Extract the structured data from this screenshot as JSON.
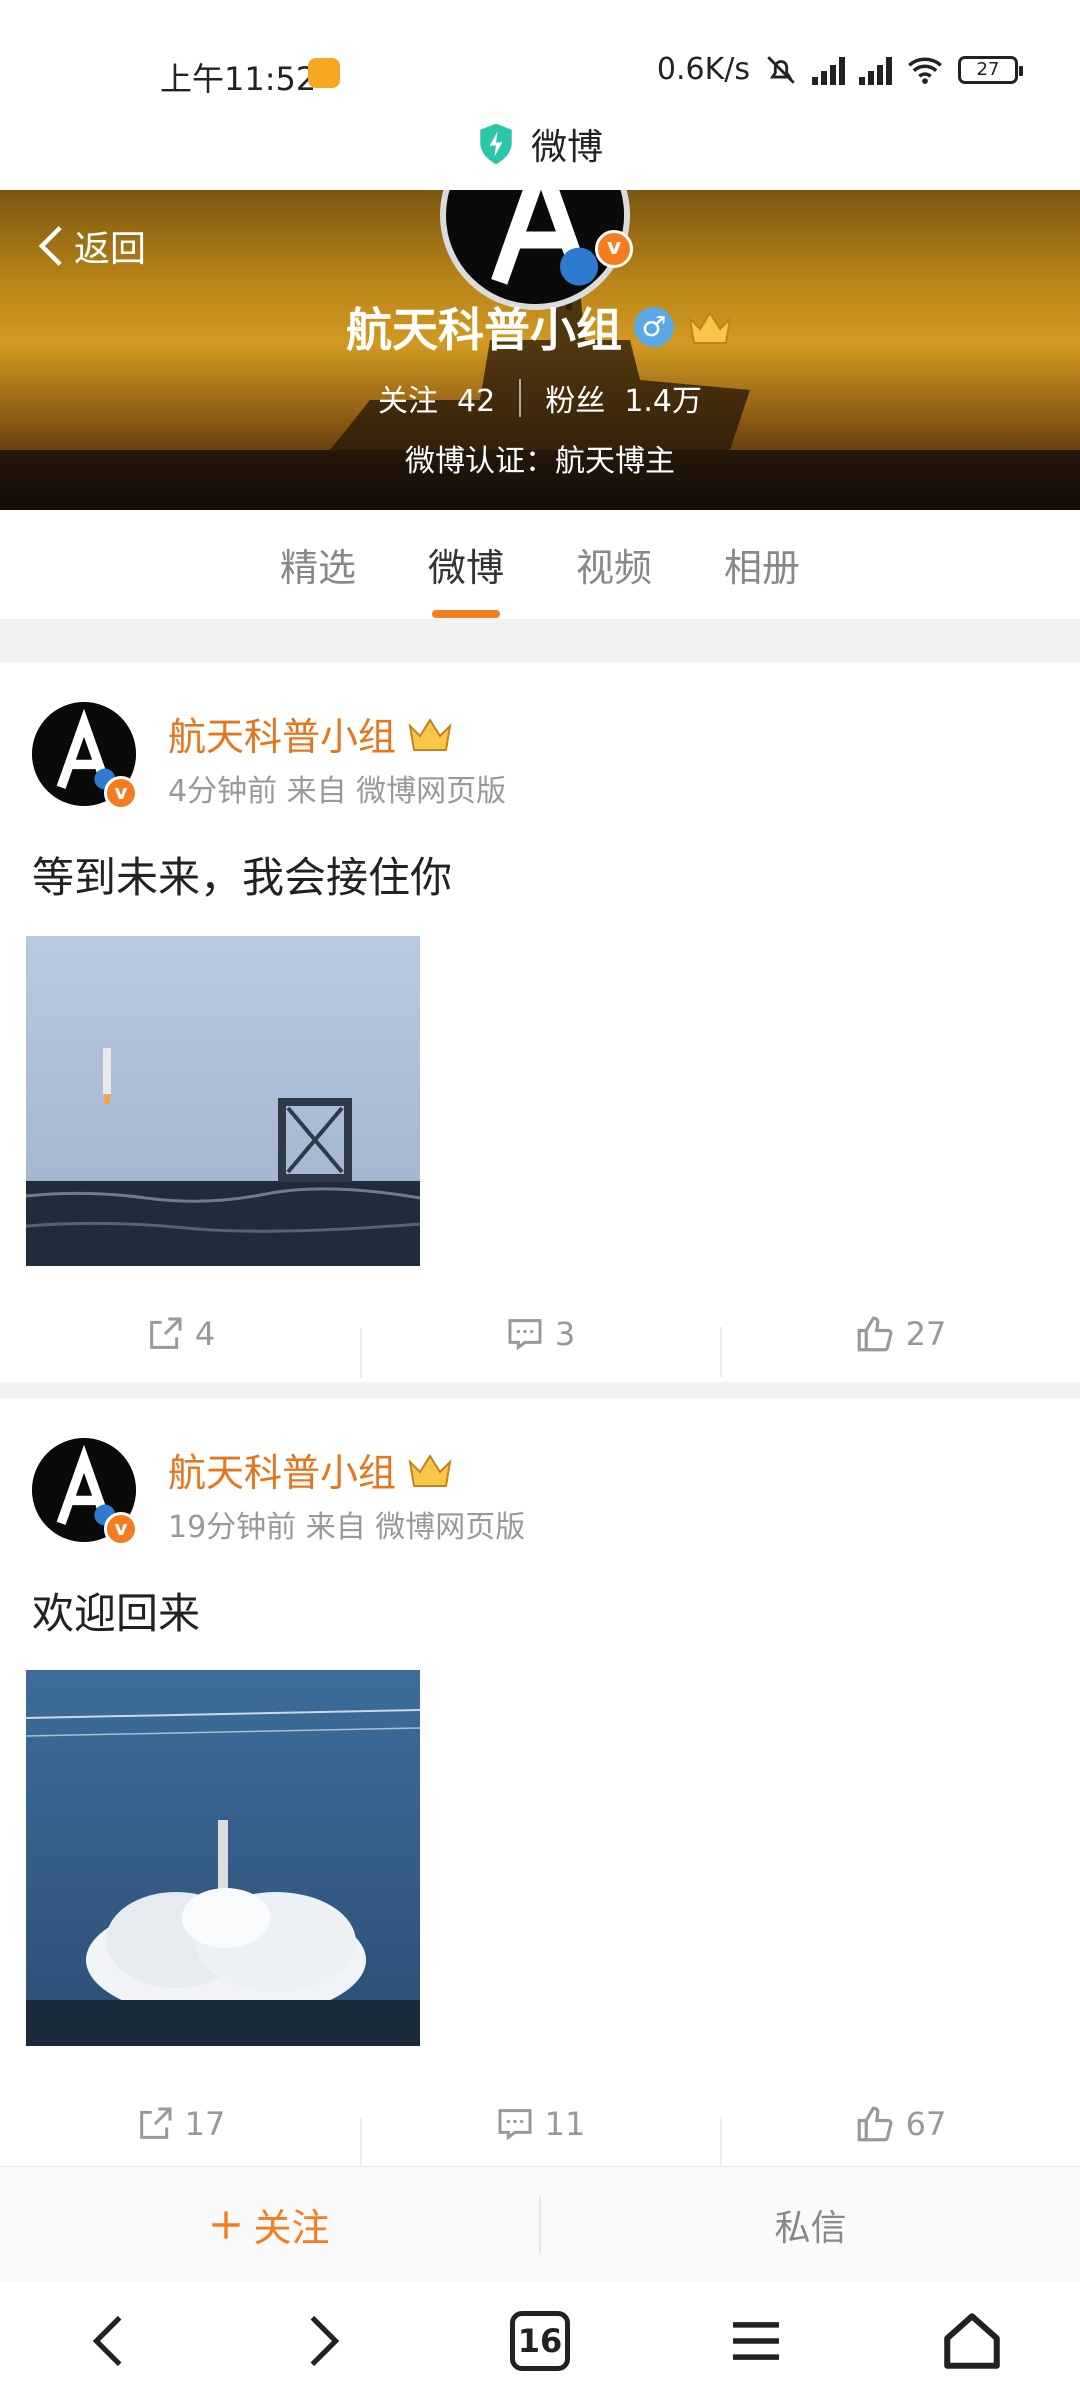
{
  "status_bar": {
    "time": "上午11:52",
    "net_speed": "0.6K/s",
    "battery": "27"
  },
  "site": {
    "title": "微博"
  },
  "header": {
    "back_label": "返回",
    "name": "航天科普小组",
    "gender": "♂",
    "following_label": "关注",
    "following_count": "42",
    "followers_label": "粉丝",
    "followers_count": "1.4万",
    "verification": "微博认证：航天博主"
  },
  "tabs": [
    {
      "label": "精选",
      "active": false
    },
    {
      "label": "微博",
      "active": true
    },
    {
      "label": "视频",
      "active": false
    },
    {
      "label": "相册",
      "active": false
    }
  ],
  "posts": [
    {
      "author": "航天科普小组",
      "meta": "4分钟前 来自 微博网页版",
      "text": "等到未来，我会接住你",
      "reposts": "4",
      "comments": "3",
      "likes": "27"
    },
    {
      "author": "航天科普小组",
      "meta": "19分钟前 来自 微博网页版",
      "text": "欢迎回来",
      "reposts": "17",
      "comments": "11",
      "likes": "67"
    }
  ],
  "bottom_actions": {
    "follow": "关注",
    "message": "私信"
  },
  "nav": {
    "tab_count": "16"
  },
  "colors": {
    "accent": "#f57c1f",
    "author": "#e8741c",
    "muted": "#999999"
  }
}
